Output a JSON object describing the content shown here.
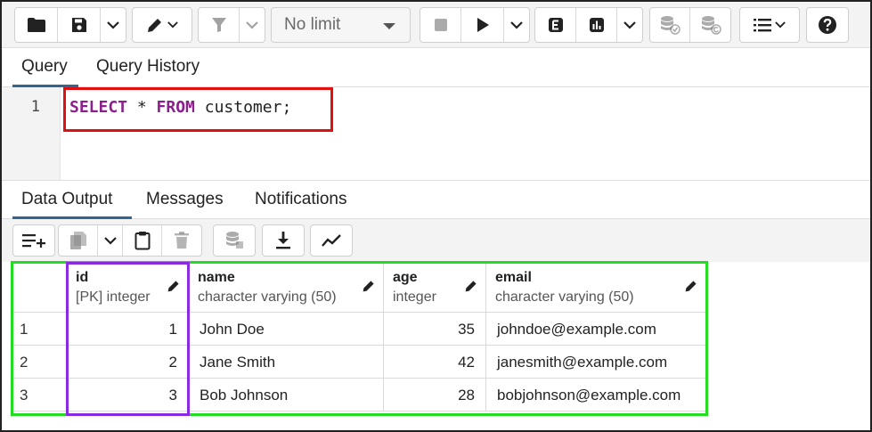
{
  "toolbar": {
    "limit_value": "No limit",
    "icons": [
      "open-file-icon",
      "save-icon",
      "chevron-down-icon",
      "edit-pencil-icon",
      "filter-icon",
      "stop-icon",
      "execute-play-icon",
      "explain-icon",
      "explain-analyze-icon",
      "commit-icon",
      "rollback-icon",
      "macros-icon",
      "help-icon"
    ]
  },
  "query_tabs": {
    "query": "Query",
    "history": "Query History"
  },
  "editor": {
    "line_number": "1",
    "kw_select": "SELECT",
    "star": " * ",
    "kw_from": "FROM",
    "rest": " customer;"
  },
  "output_tabs": {
    "data_output": "Data Output",
    "messages": "Messages",
    "notifications": "Notifications"
  },
  "grid": {
    "columns": [
      {
        "name": "id",
        "type": "[PK] integer"
      },
      {
        "name": "name",
        "type": "character varying (50)"
      },
      {
        "name": "age",
        "type": "integer"
      },
      {
        "name": "email",
        "type": "character varying (50)"
      }
    ],
    "rows": [
      {
        "rownum": "1",
        "id": "1",
        "name": "John Doe",
        "age": "35",
        "email": "johndoe@example.com"
      },
      {
        "rownum": "2",
        "id": "2",
        "name": "Jane Smith",
        "age": "42",
        "email": "janesmith@example.com"
      },
      {
        "rownum": "3",
        "id": "3",
        "name": "Bob Johnson",
        "age": "28",
        "email": "bobjohnson@example.com"
      }
    ]
  },
  "colors": {
    "highlight_red": "#e01010",
    "highlight_green": "#22dd22",
    "highlight_purple": "#8a2be2",
    "keyword": "#8b1f8b",
    "tab_accent": "#326690"
  }
}
